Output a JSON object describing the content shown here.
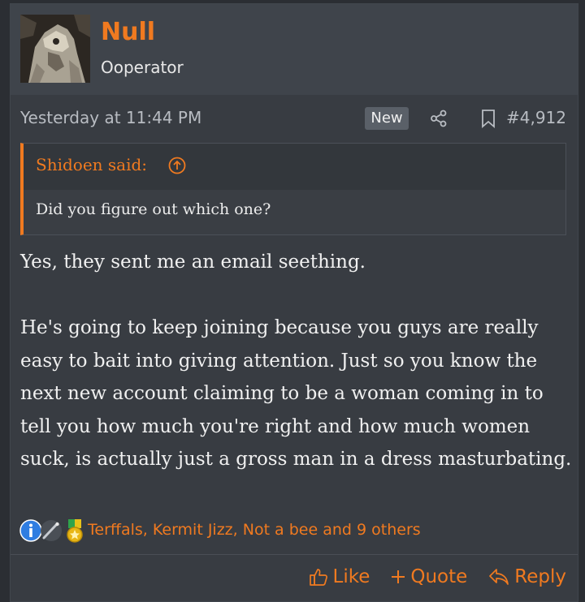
{
  "author": {
    "name": "Null",
    "title": "Ooperator"
  },
  "meta": {
    "timestamp": "Yesterday at 11:44 PM",
    "badge": "New",
    "post_number": "#4,912",
    "icons": [
      "share-icon",
      "bookmark-icon"
    ]
  },
  "quote": {
    "author_line": "Shidoen said:",
    "text": "Did you figure out which one?"
  },
  "message": {
    "paragraphs": [
      "Yes, they sent me an email seething.",
      "He's going to keep joining because you guys are really easy to bait into giving attention. Just so you know the next new account claiming to be a woman coming in to tell you how much you're right and how much women suck, is actually just a gross man in a dress masturbating."
    ]
  },
  "reactions": {
    "icons": [
      "informative-icon",
      "needle-icon",
      "medal-icon"
    ],
    "text": "Terffals, Kermit Jizz, Not a bee and 9 others"
  },
  "actions": {
    "like": "Like",
    "quote": "Quote",
    "reply": "Reply"
  },
  "colors": {
    "accent": "#f07a20",
    "background": "#2b2e33",
    "post_bg": "#383c42"
  }
}
